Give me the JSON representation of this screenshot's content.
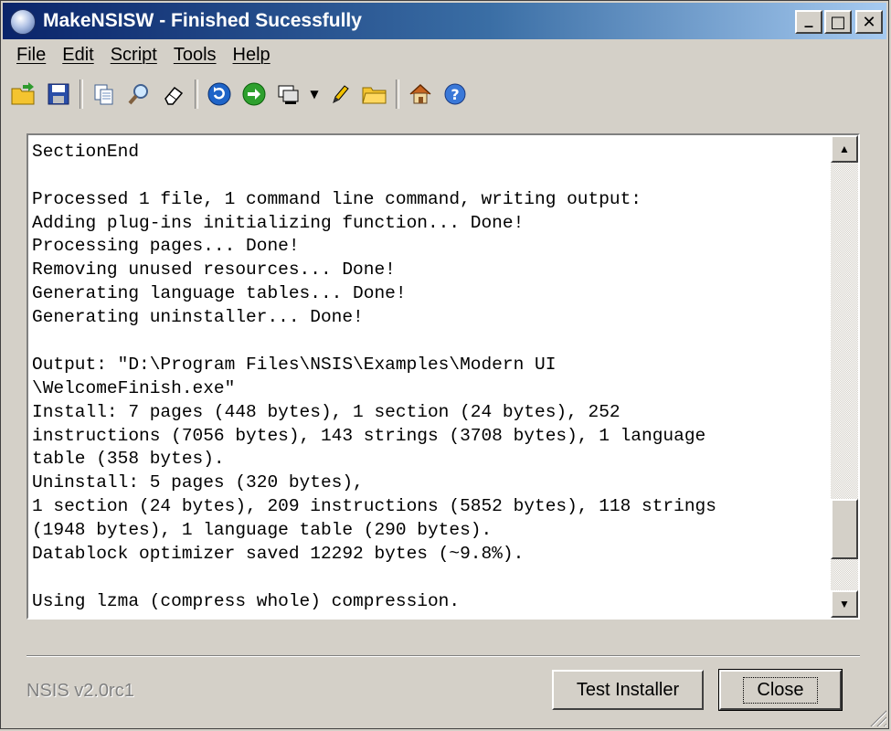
{
  "window": {
    "title": "MakeNSISW - Finished Sucessfully",
    "controls": {
      "minimize": "_",
      "maximize": "□",
      "close": "✕"
    }
  },
  "menu": {
    "file": "File",
    "edit": "Edit",
    "script": "Script",
    "tools": "Tools",
    "help": "Help"
  },
  "toolbar": {
    "icons": [
      "open-script-icon",
      "save-output-icon",
      "copy-icon",
      "find-icon",
      "clear-log-icon",
      "recompile-icon",
      "test-run-icon",
      "compressor-icon",
      "dropdown-arrow-icon",
      "edit-script-icon",
      "browse-folder-icon",
      "home-icon",
      "help-icon"
    ]
  },
  "log": {
    "lines": [
      "SectionEnd",
      "",
      "Processed 1 file, 1 command line command, writing output:",
      "Adding plug-ins initializing function... Done!",
      "Processing pages... Done!",
      "Removing unused resources... Done!",
      "Generating language tables... Done!",
      "Generating uninstaller... Done!",
      "",
      "Output: \"D:\\Program Files\\NSIS\\Examples\\Modern UI",
      "\\WelcomeFinish.exe\"",
      "Install: 7 pages (448 bytes), 1 section (24 bytes), 252",
      "instructions (7056 bytes), 143 strings (3708 bytes), 1 language",
      "table (358 bytes).",
      "Uninstall: 5 pages (320 bytes),",
      "1 section (24 bytes), 209 instructions (5852 bytes), 118 strings",
      "(1948 bytes), 1 language table (290 bytes).",
      "Datablock optimizer saved 12292 bytes (~9.8%).",
      "",
      "Using lzma (compress whole) compression."
    ]
  },
  "footer": {
    "version": "NSIS v2.0rc1",
    "test_installer": "Test Installer",
    "close": "Close"
  },
  "colors": {
    "titlebar_start": "#0a246a",
    "titlebar_end": "#a6caf0",
    "face": "#d4d0c8"
  }
}
